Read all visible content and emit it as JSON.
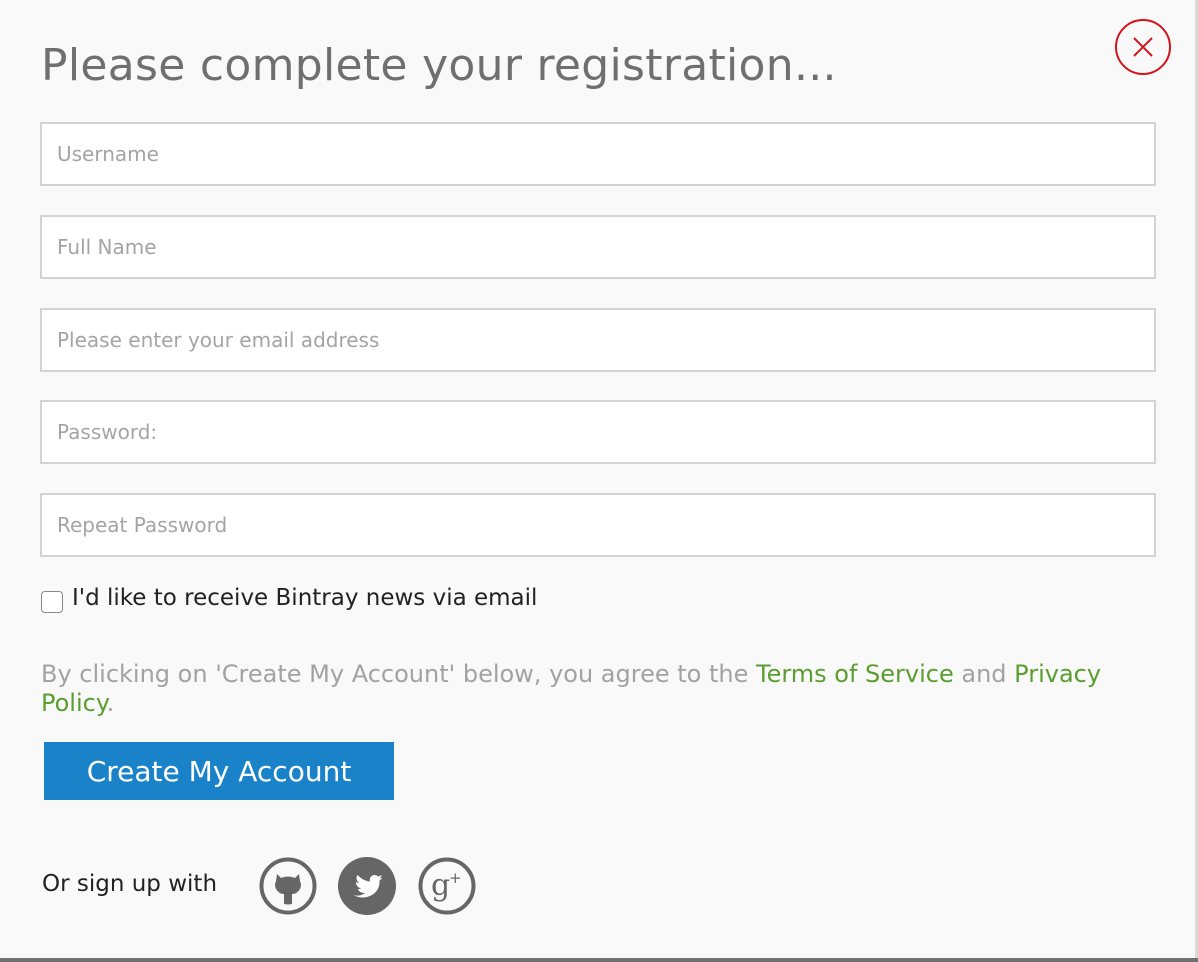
{
  "title": "Please complete your registration...",
  "close_icon": "close-circle-icon",
  "accent_color": "#1a82c8",
  "close_color": "#d4141c",
  "link_color": "#5a9e2f",
  "fields": {
    "username": {
      "placeholder": "Username",
      "value": ""
    },
    "full_name": {
      "placeholder": "Full Name",
      "value": ""
    },
    "email": {
      "placeholder": "Please enter your email address",
      "value": ""
    },
    "password": {
      "placeholder": "Password:",
      "value": ""
    },
    "repeat_password": {
      "placeholder": "Repeat Password",
      "value": ""
    }
  },
  "newsletter": {
    "label": "I'd like to receive Bintray news via email",
    "checked": false
  },
  "terms": {
    "prefix": "By clicking on 'Create My Account' below, you agree to the ",
    "tos": "Terms of Service",
    "and": " and ",
    "privacy": "Privacy Policy",
    "suffix": "."
  },
  "create_button": "Create My Account",
  "social": {
    "label": "Or sign up with",
    "providers": [
      "github-icon",
      "twitter-icon",
      "google-plus-icon"
    ]
  }
}
